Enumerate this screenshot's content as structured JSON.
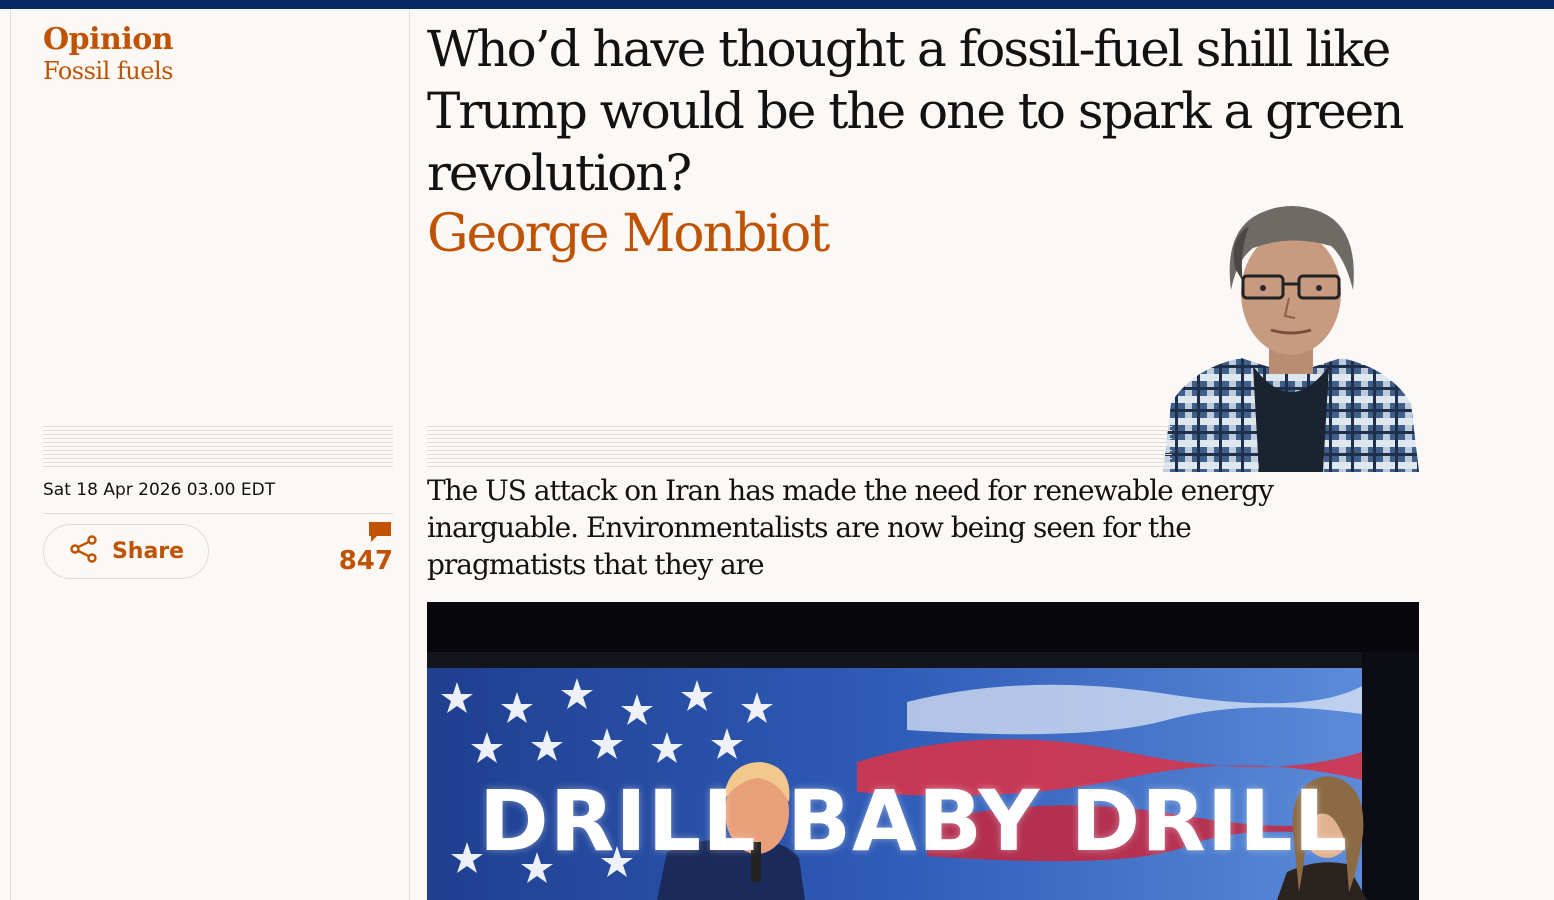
{
  "article": {
    "kicker": "Opinion",
    "series": "Fossil fuels",
    "headline": "Who’d have thought a fossil-fuel shill like Trump would be the one to spark a green revolution?",
    "byline": "George Monbiot",
    "standfirst": "The US attack on Iran has made the need for renewable energy inarguable. Environmentalists are now being seen for the pragmatists that they are"
  },
  "meta": {
    "dateline": "Sat 18 Apr 2026 03.00 EDT",
    "share_label": "Share",
    "comment_count": "847"
  },
  "image": {
    "banner_text": "DRILL BABY DRILL"
  },
  "icons": {
    "share": "share-icon",
    "comments": "comment-bubble-icon"
  },
  "colors": {
    "topbar": "#052962",
    "opinion_accent": "#c05303",
    "background": "#fbf8f6"
  }
}
